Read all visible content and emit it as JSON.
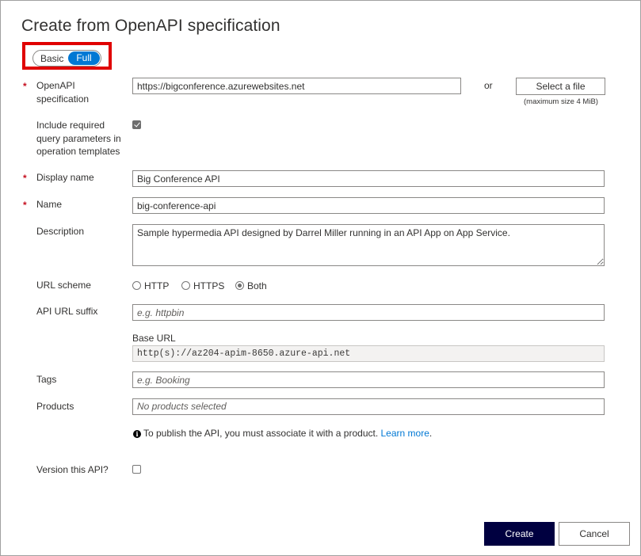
{
  "dialog": {
    "title": "Create from OpenAPI specification",
    "mode_toggle": {
      "options": [
        "Basic",
        "Full"
      ],
      "selected": "Full"
    },
    "highlight_color": "#e00000"
  },
  "form": {
    "openapi_spec": {
      "label": "OpenAPI specification",
      "required": true,
      "value": "https://bigconference.azurewebsites.net",
      "or_text": "or",
      "select_file_label": "Select a file",
      "file_hint": "(maximum size 4 MiB)"
    },
    "include_query_params": {
      "label": "Include required query parameters in operation templates",
      "checked": true
    },
    "display_name": {
      "label": "Display name",
      "required": true,
      "value": "Big Conference API"
    },
    "name": {
      "label": "Name",
      "required": true,
      "value": "big-conference-api"
    },
    "description": {
      "label": "Description",
      "value": "Sample hypermedia API designed by Darrel Miller running in an API App on App Service."
    },
    "url_scheme": {
      "label": "URL scheme",
      "options": [
        "HTTP",
        "HTTPS",
        "Both"
      ],
      "selected": "Both"
    },
    "api_url_suffix": {
      "label": "API URL suffix",
      "value": "",
      "placeholder": "e.g. httpbin"
    },
    "base_url": {
      "label": "Base URL",
      "value": "http(s)://az204-apim-8650.azure-api.net"
    },
    "tags": {
      "label": "Tags",
      "value": "",
      "placeholder": "e.g. Booking"
    },
    "products": {
      "label": "Products",
      "value": "No products selected"
    },
    "products_info": {
      "icon": "info-icon",
      "text": "To publish the API, you must associate it with a product.",
      "link_text": "Learn more",
      "trailing": "."
    },
    "version_api": {
      "label": "Version this API?",
      "checked": false
    },
    "required_marker": "*"
  },
  "footer": {
    "create_label": "Create",
    "cancel_label": "Cancel",
    "create_color": "#000040"
  }
}
